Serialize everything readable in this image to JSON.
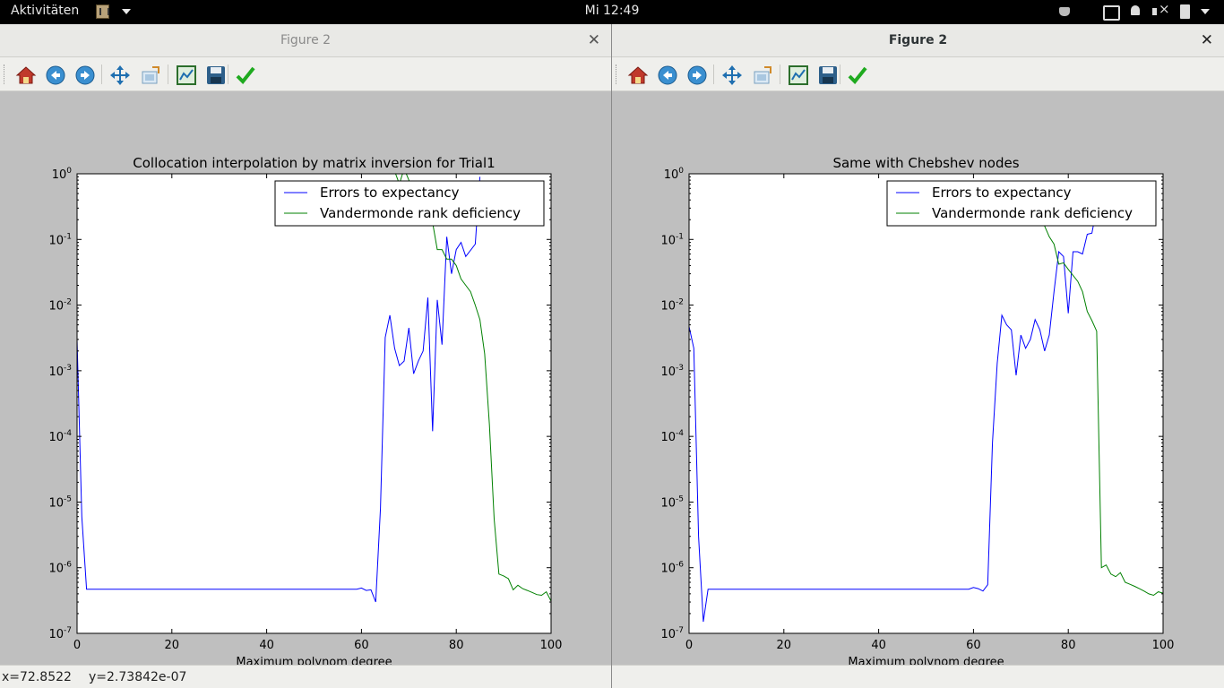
{
  "topbar": {
    "activities": "Aktivitäten",
    "clock": "Mi 12:49"
  },
  "windows": [
    {
      "title": "Figure 2",
      "status_x": "x=72.8522",
      "status_y": "y=2.73842e-07",
      "chart_data": {
        "type": "line",
        "title": "Collocation interpolation by matrix inversion for Trial1",
        "xlabel": "Maximum polynom degree",
        "ylabel": "",
        "xlim": [
          0,
          100
        ],
        "ylim": [
          1e-07,
          1
        ],
        "yscale": "log",
        "xticks": [
          0,
          20,
          40,
          60,
          80,
          100
        ],
        "yticks": [
          1e-07,
          1e-06,
          1e-05,
          0.0001,
          0.001,
          0.01,
          0.1,
          1
        ],
        "ytick_exponents": [
          "-7",
          "-6",
          "-5",
          "-4",
          "-3",
          "-2",
          "-1",
          "0"
        ],
        "ytick_base": "10",
        "legend_position": "top-right",
        "series": [
          {
            "name": "Errors to expectancy",
            "color": "#0000ff",
            "points": [
              [
                0,
                0.003
              ],
              [
                1,
                6e-06
              ],
              [
                2,
                4.7e-07
              ],
              [
                10,
                4.7e-07
              ],
              [
                20,
                4.7e-07
              ],
              [
                30,
                4.7e-07
              ],
              [
                40,
                4.7e-07
              ],
              [
                50,
                4.7e-07
              ],
              [
                59,
                4.7e-07
              ],
              [
                60,
                4.9e-07
              ],
              [
                61,
                4.5e-07
              ],
              [
                62,
                4.6e-07
              ],
              [
                63,
                3e-07
              ],
              [
                64,
                8e-06
              ],
              [
                65,
                0.0032
              ],
              [
                66,
                0.007
              ],
              [
                67,
                0.0022
              ],
              [
                68,
                0.0012
              ],
              [
                69,
                0.0014
              ],
              [
                70,
                0.0045
              ],
              [
                71,
                0.0009
              ],
              [
                72,
                0.0014
              ],
              [
                73,
                0.002
              ],
              [
                74,
                0.013
              ],
              [
                75,
                0.00012
              ],
              [
                76,
                0.012
              ],
              [
                77,
                0.0025
              ],
              [
                78,
                0.11
              ],
              [
                79,
                0.03
              ],
              [
                80,
                0.07
              ],
              [
                81,
                0.09
              ],
              [
                82,
                0.055
              ],
              [
                84,
                0.085
              ],
              [
                85,
                0.9
              ]
            ]
          },
          {
            "name": "Vandermonde rank deficiency",
            "color": "#008000",
            "points": [
              [
                67,
                1.1
              ],
              [
                68,
                0.7
              ],
              [
                69,
                1.2
              ],
              [
                70,
                0.8
              ],
              [
                72,
                0.4
              ],
              [
                74,
                0.25
              ],
              [
                75,
                0.18
              ],
              [
                76,
                0.07
              ],
              [
                77,
                0.07
              ],
              [
                78,
                0.05
              ],
              [
                79,
                0.05
              ],
              [
                80,
                0.04
              ],
              [
                81,
                0.025
              ],
              [
                82,
                0.02
              ],
              [
                83,
                0.016
              ],
              [
                84,
                0.01
              ],
              [
                85,
                0.006
              ],
              [
                86,
                0.0018
              ],
              [
                87,
                0.00015
              ],
              [
                88,
                5.5e-06
              ],
              [
                89,
                8e-07
              ],
              [
                90,
                7.5e-07
              ],
              [
                91,
                6.8e-07
              ],
              [
                92,
                4.6e-07
              ],
              [
                93,
                5.4e-07
              ],
              [
                94,
                4.8e-07
              ],
              [
                95,
                4.5e-07
              ],
              [
                96,
                4.2e-07
              ],
              [
                97,
                3.9e-07
              ],
              [
                98,
                3.8e-07
              ],
              [
                99,
                4.3e-07
              ],
              [
                100,
                3.1e-07
              ]
            ]
          }
        ]
      }
    },
    {
      "title": "Figure 2",
      "status_x": "",
      "status_y": "",
      "chart_data": {
        "type": "line",
        "title": "Same with Chebshev nodes",
        "xlabel": "Maximum polynom degree",
        "ylabel": "",
        "xlim": [
          0,
          100
        ],
        "ylim": [
          1e-07,
          1
        ],
        "yscale": "log",
        "xticks": [
          0,
          20,
          40,
          60,
          80,
          100
        ],
        "yticks": [
          1e-07,
          1e-06,
          1e-05,
          0.0001,
          0.001,
          0.01,
          0.1,
          1
        ],
        "ytick_exponents": [
          "-7",
          "-6",
          "-5",
          "-4",
          "-3",
          "-2",
          "-1",
          "0"
        ],
        "ytick_base": "10",
        "legend_position": "top-right",
        "series": [
          {
            "name": "Errors to expectancy",
            "color": "#0000ff",
            "points": [
              [
                0,
                0.0047
              ],
              [
                1,
                0.0022
              ],
              [
                2,
                3e-06
              ],
              [
                3,
                1.5e-07
              ],
              [
                4,
                4.7e-07
              ],
              [
                10,
                4.7e-07
              ],
              [
                20,
                4.7e-07
              ],
              [
                30,
                4.7e-07
              ],
              [
                40,
                4.7e-07
              ],
              [
                50,
                4.7e-07
              ],
              [
                59,
                4.7e-07
              ],
              [
                60,
                5e-07
              ],
              [
                61,
                4.8e-07
              ],
              [
                62,
                4.4e-07
              ],
              [
                63,
                5.5e-07
              ],
              [
                64,
                8e-05
              ],
              [
                65,
                0.0013
              ],
              [
                66,
                0.007
              ],
              [
                67,
                0.005
              ],
              [
                68,
                0.0042
              ],
              [
                69,
                0.00085
              ],
              [
                70,
                0.0035
              ],
              [
                71,
                0.0022
              ],
              [
                72,
                0.003
              ],
              [
                73,
                0.006
              ],
              [
                74,
                0.0042
              ],
              [
                75,
                0.002
              ],
              [
                76,
                0.0035
              ],
              [
                77,
                0.016
              ],
              [
                78,
                0.065
              ],
              [
                79,
                0.055
              ],
              [
                80,
                0.0075
              ],
              [
                81,
                0.065
              ],
              [
                82,
                0.065
              ],
              [
                83,
                0.06
              ],
              [
                84,
                0.12
              ],
              [
                85,
                0.125
              ],
              [
                86,
                0.3
              ]
            ]
          },
          {
            "name": "Vandermonde rank deficiency",
            "color": "#008000",
            "points": [
              [
                74,
                0.3
              ],
              [
                75,
                0.16
              ],
              [
                76,
                0.11
              ],
              [
                77,
                0.085
              ],
              [
                78,
                0.042
              ],
              [
                79,
                0.044
              ],
              [
                80,
                0.035
              ],
              [
                82,
                0.023
              ],
              [
                83,
                0.016
              ],
              [
                84,
                0.008
              ],
              [
                85,
                0.0058
              ],
              [
                86,
                0.004
              ],
              [
                87,
                1e-06
              ],
              [
                88,
                1.1e-06
              ],
              [
                89,
                8e-07
              ],
              [
                90,
                7.3e-07
              ],
              [
                91,
                8.4e-07
              ],
              [
                92,
                6e-07
              ],
              [
                93,
                5.6e-07
              ],
              [
                94,
                5.2e-07
              ],
              [
                95,
                4.8e-07
              ],
              [
                96,
                4.4e-07
              ],
              [
                97,
                4e-07
              ],
              [
                98,
                3.8e-07
              ],
              [
                99,
                4.3e-07
              ],
              [
                100,
                4.1e-07
              ]
            ]
          }
        ]
      }
    }
  ],
  "toolbar": {
    "buttons": [
      "home",
      "back",
      "forward",
      "pan",
      "zoom",
      "subplots",
      "save",
      "edit-parameters"
    ]
  }
}
